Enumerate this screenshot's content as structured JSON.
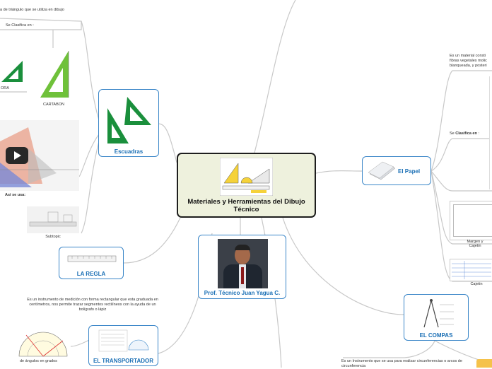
{
  "central": {
    "title": "Materiales y Herramientas del Dibujo Técnico"
  },
  "nodes": {
    "escuadras": "Escuadras",
    "la_regla": "LA REGLA",
    "el_transportador": "EL TRANSPORTADOR",
    "profesor": "Prof. Técnico Juan Yagua C.",
    "el_papel": "El Papel",
    "el_compas": "EL COMPAS"
  },
  "texts": {
    "triangulo_top": "a de triángulo  que se utiliza en dibujo",
    "se_clasifica": "Se Clasifica en :",
    "escuadra_cap": "ORA",
    "cartabon_cap": "CARTABON",
    "asi_se_usa": "Asi se usa:",
    "subtopic": "Subtopic",
    "regla_desc": "Es un instrumento de medición con forma rectangular que esta graduada en centímetros, nos permite trazar segmentos rectilíneos con la ayuda de un bolígrafo o lápiz",
    "angulos_cap": "de ángulos en grados",
    "papel_desc": "Es un material consti fibras vegetales molic blanqueada, y posteri",
    "papel_clasifica_prefix": "Se",
    "papel_clasifica_bold": "Clasifica en",
    "papel_clasifica_suffix": ":",
    "margen_cap": "Margen y Cajetin",
    "cajetin_cap": "Cajetin",
    "compas_desc": "Es un Instrumento que se usa para realizar circunferencias o arcos de circunferencia"
  },
  "colors": {
    "node_border": "#3a86c8",
    "node_text": "#1a6fb5",
    "central_bg": "#eef1dd",
    "link": "#c8c8c8",
    "triangle": "#1a8f3c"
  }
}
